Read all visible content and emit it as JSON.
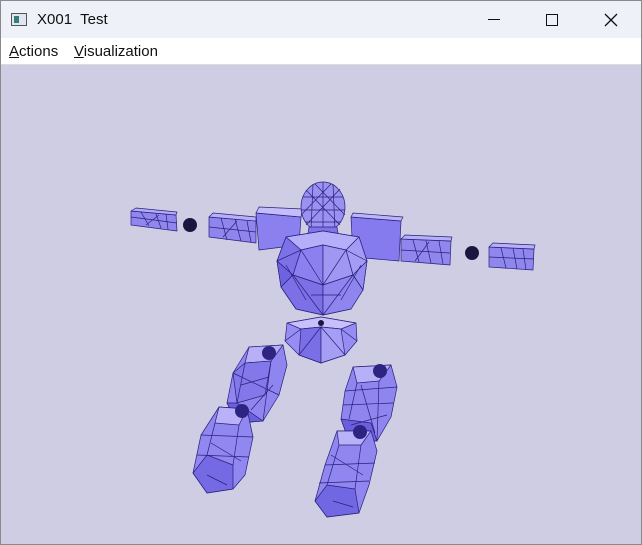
{
  "window": {
    "title": "X001  Test",
    "icons": {
      "app": "app-window-icon",
      "minimize": "minimize-icon",
      "maximize": "maximize-icon",
      "close": "close-icon"
    }
  },
  "menu": {
    "items": [
      {
        "label": "Actions"
      },
      {
        "label": "Visualization"
      }
    ]
  },
  "viewport": {
    "background_color": "#cecde3",
    "model_fill_color": "#8b80f0",
    "mesh_line_color": "#2a1f7a",
    "joint_color": "#1b1640"
  }
}
